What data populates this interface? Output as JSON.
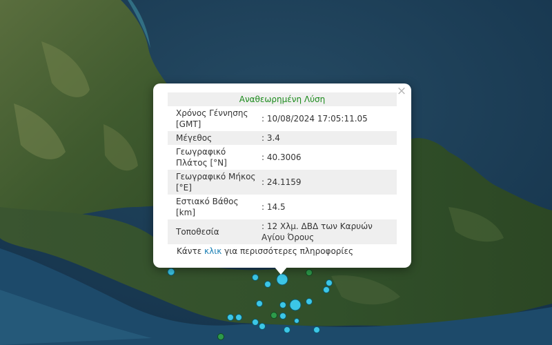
{
  "popup": {
    "close_symbol": "×",
    "header": "Αναθεωρημένη Λύση",
    "rows": [
      {
        "label": "Χρόνος Γέννησης [GMT]",
        "value": ": 10/08/2024 17:05:11.05"
      },
      {
        "label": "Μέγεθος",
        "value": ": 3.4"
      },
      {
        "label": "Γεωγραφικό Πλάτος [°N]",
        "value": ": 40.3006"
      },
      {
        "label": "Γεωγραφικό Μήκος [°E]",
        "value": ": 24.1159"
      },
      {
        "label": "Εστιακό Βάθος [km]",
        "value": ": 14.5"
      },
      {
        "label": "Τοποθεσία",
        "value": ": 12 Χλμ. ΔΒΔ των Καρυών Αγίου Όρους"
      }
    ],
    "more_prefix": "Κάντε ",
    "more_link": "κλικ",
    "more_suffix": " για περισσότερες πληροφορίες"
  },
  "colors": {
    "revised_header": "#1a8a1a",
    "link": "#1a7fb4",
    "marker_cyan": "#3cc6e6",
    "marker_green": "#2e9a4a"
  },
  "icons": [
    "close-icon",
    "earthquake-marker"
  ]
}
